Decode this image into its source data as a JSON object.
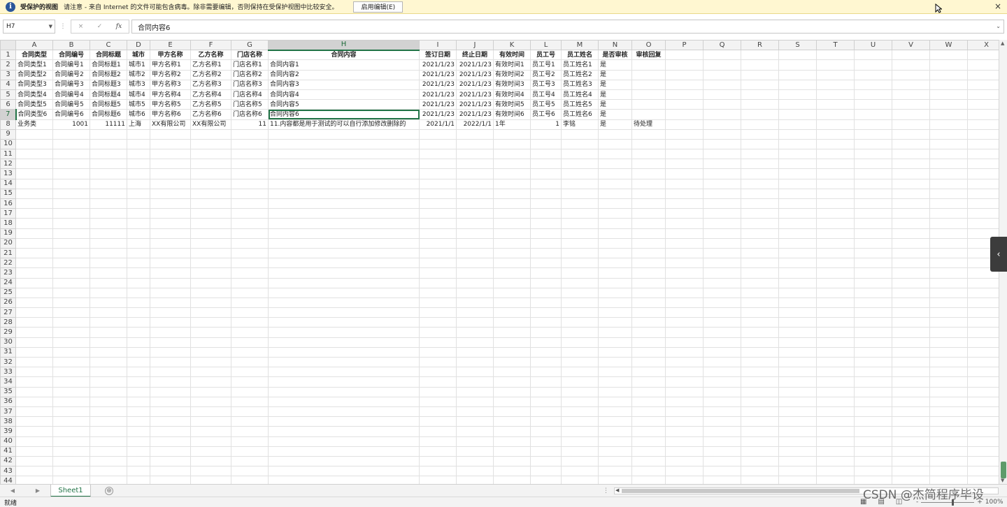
{
  "protected_view": {
    "title": "受保护的视图",
    "message": "请注意 - 来自 Internet 的文件可能包含病毒。除非需要编辑，否则保持在受保护视图中比较安全。",
    "enable_button": "启用编辑(E)",
    "close": "×"
  },
  "formula_bar": {
    "name_box": "H7",
    "cancel": "×",
    "enter": "✓",
    "fx": "fx",
    "content": "合同内容6"
  },
  "columns": [
    "A",
    "B",
    "C",
    "D",
    "E",
    "F",
    "G",
    "H",
    "I",
    "J",
    "K",
    "L",
    "M",
    "N",
    "O",
    "P",
    "Q",
    "R",
    "S",
    "T",
    "U",
    "V",
    "W",
    "X"
  ],
  "header_row": [
    "合同类型",
    "合同编号",
    "合同标题",
    "城市",
    "甲方名称",
    "乙方名称",
    "门店名称",
    "合同内容",
    "签订日期",
    "终止日期",
    "有效时间",
    "员工号",
    "员工姓名",
    "是否审核",
    "审核回复"
  ],
  "data_rows": [
    [
      "合同类型1",
      "合同编号1",
      "合同标题1",
      "城市1",
      "甲方名称1",
      "乙方名称1",
      "门店名称1",
      "合同内容1",
      "2021/1/23",
      "2021/1/23",
      "有效时间1",
      "员工号1",
      "员工姓名1",
      "是",
      ""
    ],
    [
      "合同类型2",
      "合同编号2",
      "合同标题2",
      "城市2",
      "甲方名称2",
      "乙方名称2",
      "门店名称2",
      "合同内容2",
      "2021/1/23",
      "2021/1/23",
      "有效时间2",
      "员工号2",
      "员工姓名2",
      "是",
      ""
    ],
    [
      "合同类型3",
      "合同编号3",
      "合同标题3",
      "城市3",
      "甲方名称3",
      "乙方名称3",
      "门店名称3",
      "合同内容3",
      "2021/1/23",
      "2021/1/23",
      "有效时间3",
      "员工号3",
      "员工姓名3",
      "是",
      ""
    ],
    [
      "合同类型4",
      "合同编号4",
      "合同标题4",
      "城市4",
      "甲方名称4",
      "乙方名称4",
      "门店名称4",
      "合同内容4",
      "2021/1/23",
      "2021/1/23",
      "有效时间4",
      "员工号4",
      "员工姓名4",
      "是",
      ""
    ],
    [
      "合同类型5",
      "合同编号5",
      "合同标题5",
      "城市5",
      "甲方名称5",
      "乙方名称5",
      "门店名称5",
      "合同内容5",
      "2021/1/23",
      "2021/1/23",
      "有效时间5",
      "员工号5",
      "员工姓名5",
      "是",
      ""
    ],
    [
      "合同类型6",
      "合同编号6",
      "合同标题6",
      "城市6",
      "甲方名称6",
      "乙方名称6",
      "门店名称6",
      "合同内容6",
      "2021/1/23",
      "2021/1/23",
      "有效时间6",
      "员工号6",
      "员工姓名6",
      "是",
      ""
    ],
    [
      "业务类",
      "1001",
      "11111",
      "上海",
      "XX有限公司",
      "XX有限公司",
      "11",
      "11.内容都是用于测试的可以自行添加修改删除的",
      "2021/1/1",
      "2022/1/1",
      "1年",
      "1",
      "李铭",
      "是",
      "待处理"
    ]
  ],
  "numeric_cols": [
    8,
    9
  ],
  "numeric_last_row_cols": [
    1,
    2,
    6,
    8,
    9,
    11
  ],
  "active_cell": {
    "row": 7,
    "col": 7
  },
  "row_count": 48,
  "sheet_tab": "Sheet1",
  "add_sheet": "⊕",
  "status": {
    "ready": "就绪",
    "zoom": "100%",
    "minus": "-",
    "plus": "+"
  },
  "watermark": "CSDN @杰简程序毕设"
}
